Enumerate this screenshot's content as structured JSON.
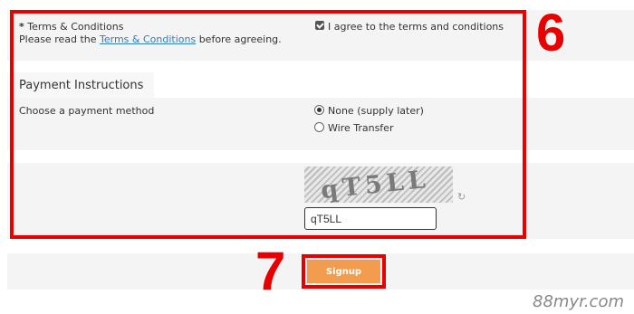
{
  "terms": {
    "required_mark": "*",
    "title": "Terms & Conditions",
    "desc_prefix": "Please read the",
    "link_text": "Terms & Conditions",
    "desc_suffix": "before agreeing.",
    "agree_label": "I agree to the terms and conditions",
    "agreed": true
  },
  "payment": {
    "heading": "Payment Instructions",
    "prompt": "Choose a payment method",
    "options": [
      {
        "label": "None (supply later)",
        "selected": true
      },
      {
        "label": "Wire Transfer",
        "selected": false
      }
    ]
  },
  "captcha": {
    "image_text": "qT5LL",
    "input_value": "qT5LL",
    "refresh_icon": "refresh-icon"
  },
  "signup": {
    "label": "Signup",
    "color": "#f39c4e"
  },
  "annotations": {
    "step_6": "6",
    "step_7": "7",
    "highlight_color": "#e80000"
  },
  "watermark": "88myr.com"
}
